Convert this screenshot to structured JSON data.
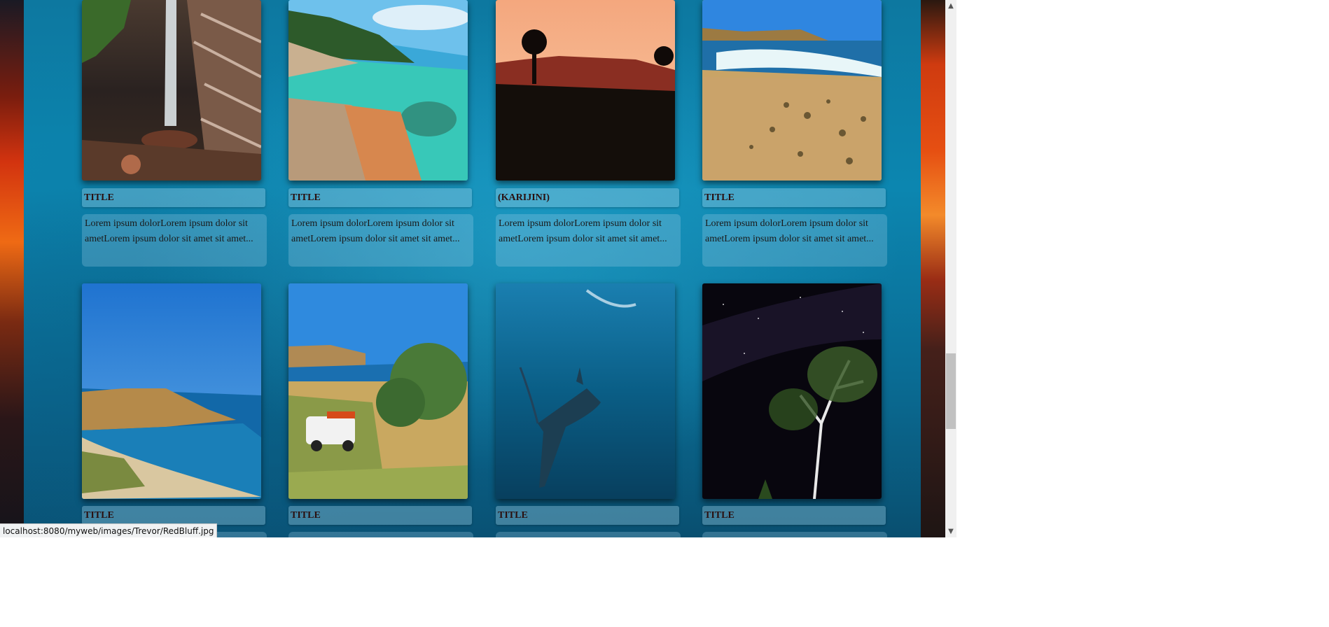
{
  "status_bar": {
    "url": "localhost:8080/myweb/images/Trevor/RedBluff.jpg"
  },
  "gallery": {
    "rows": [
      {
        "cards": [
          {
            "photo": "waterfall",
            "title": "TITLE",
            "text": "Lorem ipsum dolorLorem ipsum dolor sit ametLorem ipsum dolor sit amet sit amet..."
          },
          {
            "photo": "turquoise-bay-rocks",
            "title": "TITLE",
            "text": "Lorem ipsum dolorLorem ipsum dolor sit ametLorem ipsum dolor sit amet sit amet..."
          },
          {
            "photo": "red-mesa-sunset",
            "title": "(KARIJINI)",
            "text": "Lorem ipsum dolorLorem ipsum dolor sit ametLorem ipsum dolor sit amet sit amet..."
          },
          {
            "photo": "reef-beach-waves",
            "title": "TITLE",
            "text": "Lorem ipsum dolorLorem ipsum dolor sit ametLorem ipsum dolor sit amet sit amet..."
          }
        ]
      },
      {
        "cards": [
          {
            "photo": "red-bluff-coast",
            "title": "TITLE",
            "text": ""
          },
          {
            "photo": "campsite-4wd",
            "title": "TITLE",
            "text": ""
          },
          {
            "photo": "whale-shark",
            "title": "TITLE",
            "text": ""
          },
          {
            "photo": "night-sky-trees",
            "title": "TITLE",
            "text": ""
          }
        ]
      }
    ]
  }
}
